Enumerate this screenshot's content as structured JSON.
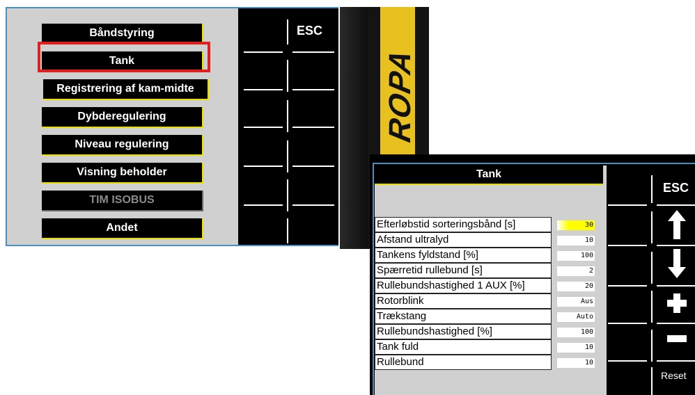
{
  "menu_screen": {
    "items": [
      {
        "label": "Båndstyring",
        "state": "normal"
      },
      {
        "label": "Tank",
        "state": "selected"
      },
      {
        "label": "Registrering af kam-midte",
        "state": "normal"
      },
      {
        "label": "Dybderegulering",
        "state": "normal"
      },
      {
        "label": "Niveau regulering",
        "state": "normal"
      },
      {
        "label": "Visning beholder",
        "state": "normal"
      },
      {
        "label": "TIM ISOBUS",
        "state": "disabled"
      },
      {
        "label": "Andet",
        "state": "normal"
      }
    ],
    "softkeys": {
      "esc": "ESC"
    }
  },
  "brand": {
    "logo_text": "ROPA",
    "color": "#e8c020"
  },
  "tank_screen": {
    "title": "Tank",
    "rows": [
      {
        "label": "Efterløbstid sorteringsbånd [s]",
        "value": "30",
        "highlighted": true
      },
      {
        "label": "Afstand ultralyd",
        "value": "10"
      },
      {
        "label": "Tankens fyldstand [%]",
        "value": "100"
      },
      {
        "label": "Spærretid rullebund [s]",
        "value": "2"
      },
      {
        "label": "Rullebundshastighed 1 AUX [%]",
        "value": "20"
      },
      {
        "label": "Rotorblink",
        "value": "Aus"
      },
      {
        "label": "Trækstang",
        "value": "Auto"
      },
      {
        "label": "Rullebundshastighed [%]",
        "value": "100"
      },
      {
        "label": "Tank fuld",
        "value": "10"
      },
      {
        "label": "Rullebund",
        "value": "10"
      }
    ],
    "softkeys": {
      "esc": "ESC",
      "up": "up-arrow-icon",
      "down": "down-arrow-icon",
      "plus": "plus-icon",
      "minus": "minus-icon",
      "reset": "Reset"
    }
  },
  "colors": {
    "accent_yellow": "#e8e000",
    "selection_red": "#e02020",
    "frame_blue": "#4a8fc0"
  }
}
